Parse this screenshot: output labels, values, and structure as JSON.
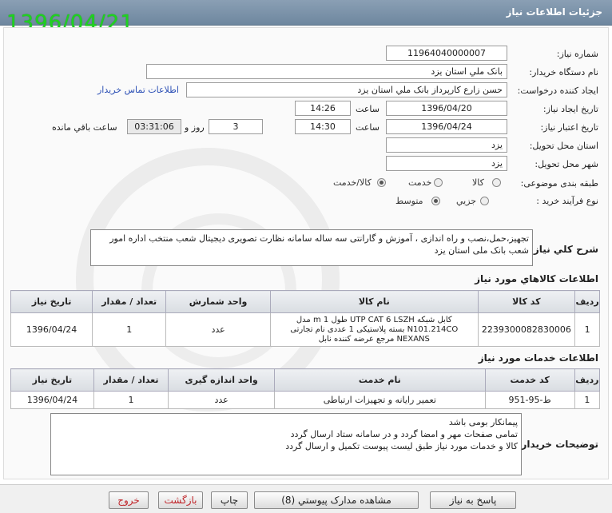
{
  "window": {
    "title": "جزئيات اطلاعات نياز",
    "date_stamp": "1396/04/21"
  },
  "form": {
    "need_number_label": "شماره نياز:",
    "need_number": "1196404000000​7",
    "buyer_org_label": "نام دستگاه خريدار:",
    "buyer_org": "بانک ملي استان يزد",
    "requester_label": "ايجاد کننده درخواست:",
    "requester": "حسن زارع کارپرداز بانک ملي استان يزد",
    "contact_link": "اطلاعات تماس خريدار",
    "created_label": "تاريخ ايجاد نياز:",
    "created_date": "1396/04/20",
    "time_label": "ساعت",
    "created_time": "14:26",
    "validity_label": "تاريخ اعتبار نياز:",
    "validity_date": "1396/04/24",
    "validity_time": "14:30",
    "days_value": "3",
    "days_label": "روز و",
    "remaining_time": "03:31:06",
    "remaining_label": "ساعت باقي مانده",
    "province_label": "استان محل تحويل:",
    "province": "يزد",
    "city_label": "شهر محل تحويل:",
    "city": "يزد",
    "category_label": "طبقه بندی موضوعی:",
    "category_options": [
      "کالا",
      "خدمت",
      "کالا/خدمت"
    ],
    "category_selected": "کالا/خدمت",
    "process_label": "نوع فرآيند خريد :",
    "process_options": [
      "جزيي",
      "متوسط"
    ],
    "process_selected": "متوسط"
  },
  "summary": {
    "label": "شرح کلي نياز:",
    "text": "تجهيز،حمل،نصب و راه اندازی ، آموزش و گارانتی سه ساله سامانه نظارت تصويری ديجيتال شعب منتخب اداره امور شعب بانک ملی استان يزد"
  },
  "goods": {
    "section_title": "اطلاعات کالاهاي مورد نياز",
    "headers": [
      "رديف",
      "کد کالا",
      "نام کالا",
      "واحد شمارش",
      "تعداد / مقدار",
      "تاريخ نياز"
    ],
    "rows": [
      {
        "row": "1",
        "code": "2239300082830006",
        "name": "کابل شبکه UTP CAT 6 LSZH طول 1 m مدل N101.214CO بسته پلاستيکی 1 عددی نام تجارتی NEXANS مرجع عرضه کننده نابل",
        "unit": "عدد",
        "qty": "1",
        "date": "1396/04/24"
      }
    ]
  },
  "services": {
    "section_title": "اطلاعات خدمات مورد نياز",
    "headers": [
      "رديف",
      "کد خدمت",
      "نام خدمت",
      "واحد اندازه گيری",
      "تعداد / مقدار",
      "تاريخ نياز"
    ],
    "rows": [
      {
        "row": "1",
        "code": "ط-95-951",
        "name": "تعمير رايانه و تجهيزات ارتباطی",
        "unit": "عدد",
        "qty": "1",
        "date": "1396/04/24"
      }
    ]
  },
  "buyer_notes": {
    "label": "توضيحات خريدار:",
    "lines": [
      "پيمانکار بومی باشد",
      "تمامی صفحات مهر و امضا گردد و در سامانه ستاد ارسال گردد",
      "کالا  و خدمات مورد نياز طبق ليست پيوست تکميل و ارسال گردد"
    ]
  },
  "buttons": {
    "reply": "پاسخ به نياز",
    "attachments": "مشاهده مدارک پيوستي (8)",
    "print": "چاپ",
    "back": "بازگشت",
    "exit": "خروج"
  },
  "colors": {
    "title_bar": "#7b93aa",
    "stamp": "#1fd21f",
    "link": "#2b4fb5",
    "danger_button_text": "#c0252a"
  }
}
